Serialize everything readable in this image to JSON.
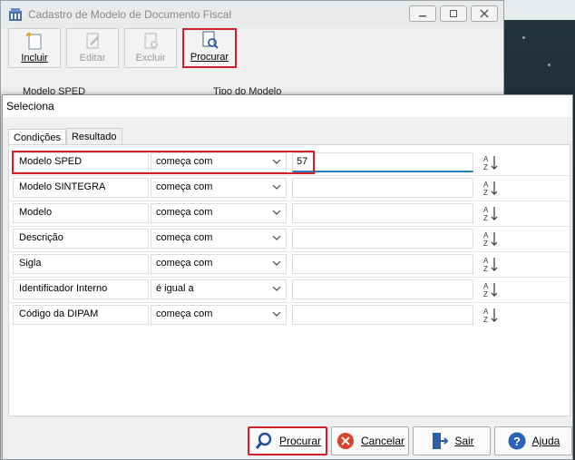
{
  "background_window": {
    "title": "Cadastro de Modelo de Documento Fiscal",
    "toolbar": {
      "incluir": "Incluir",
      "editar": "Editar",
      "excluir": "Excluir",
      "procurar": "Procurar"
    },
    "labels": {
      "modelo_sped": "Modelo SPED",
      "tipo_modelo": "Tipo do Modelo"
    }
  },
  "dialog": {
    "title": "Seleciona",
    "tabs": [
      "Condições",
      "Resultado"
    ],
    "rows": [
      {
        "label": "Modelo SPED",
        "operator": "começa com",
        "value": "57"
      },
      {
        "label": "Modelo SINTEGRA",
        "operator": "começa com",
        "value": ""
      },
      {
        "label": "Modelo",
        "operator": "começa com",
        "value": ""
      },
      {
        "label": "Descrição",
        "operator": "começa com",
        "value": ""
      },
      {
        "label": "Sigla",
        "operator": "começa com",
        "value": ""
      },
      {
        "label": "Identificador Interno",
        "operator": "é igual a",
        "value": ""
      },
      {
        "label": "Código da DIPAM",
        "operator": "começa com",
        "value": ""
      }
    ],
    "footer": {
      "procurar": "Procurar",
      "cancelar": "Cancelar",
      "sair": "Sair",
      "ajuda": "Ajuda"
    }
  },
  "colors": {
    "highlight": "#d0202a",
    "accent_blue": "#2a7ab7"
  }
}
